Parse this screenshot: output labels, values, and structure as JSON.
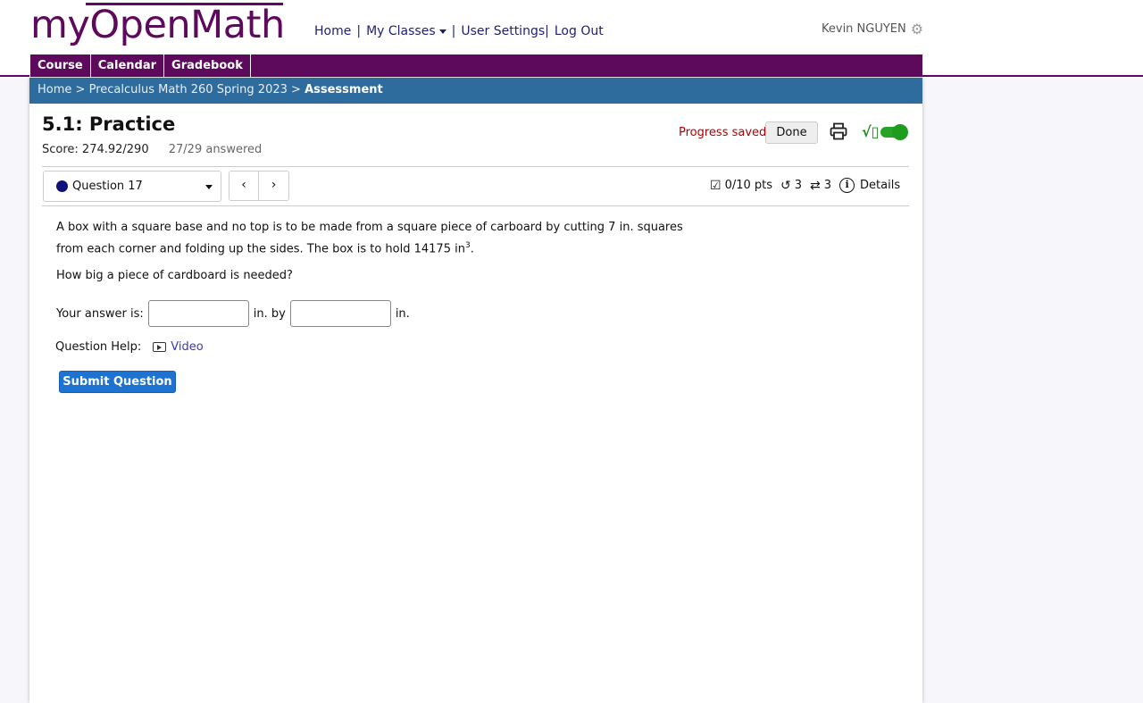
{
  "header": {
    "logo_text": "myOpenMath",
    "nav": {
      "home": "Home",
      "my_classes": "My Classes",
      "user_settings": "User Settings",
      "logout": "Log Out",
      "sep1": "|",
      "sep2": "|",
      "sep3": "|"
    },
    "user_name": "Kevin NGUYEN"
  },
  "navbar": {
    "tabs": [
      "Course",
      "Calendar",
      "Gradebook"
    ]
  },
  "breadcrumb": {
    "home": "Home",
    "course": "Precalculus Math 260 Spring 2023",
    "current": "Assessment",
    "sep": ">"
  },
  "assessment": {
    "title": "5.1: Practice",
    "score": "Score: 274.92/290",
    "answered": "27/29 answered",
    "progress_status": "Progress saved",
    "done_label": "Done"
  },
  "question_nav": {
    "selected": "Question 17",
    "prev": "‹",
    "next": "›",
    "points": "0/10 pts",
    "retries": "3",
    "regens": "3",
    "details": "Details"
  },
  "question": {
    "text_part1": "A box with a square base and no top is to be made from a square piece of carboard by cutting 7 in. squares from each corner and folding up the sides. The box is to hold 14175 in",
    "text_sup": "3",
    "text_end": ".",
    "prompt": "How big a piece of cardboard is needed?",
    "answer_label": "Your answer is:",
    "unit_by": "in. by",
    "unit_end": "in.",
    "answer1_value": "",
    "answer2_value": "",
    "help_label": "Question Help:",
    "video_label": "Video",
    "submit_label": "Submit Question"
  },
  "icons": {
    "settings": "gear-icon",
    "print": "print-icon",
    "math_toggle": "math-entry-toggle-icon",
    "points": "checkbox-icon",
    "retries": "retry-icon",
    "regens": "regen-icon",
    "details": "info-icon",
    "video": "video-icon"
  },
  "colors": {
    "brand": "#5e0a5c",
    "breadcrumb_bg": "#2f6c9e",
    "submit_bg": "#1e73d1",
    "status_red": "#b00000",
    "toggle_green": "#27a327"
  }
}
